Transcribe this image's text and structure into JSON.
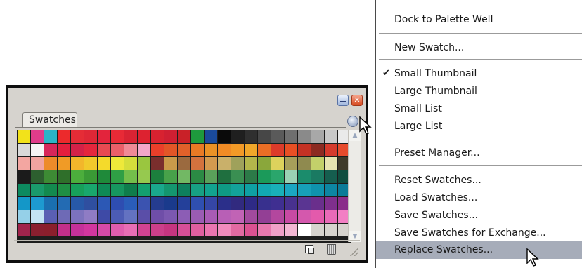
{
  "palette": {
    "tab_label": "Swatches",
    "close_glyph": "✕",
    "scroll_up": "▲",
    "scroll_down": "▼",
    "swatch_colors": [
      "#f2e21a",
      "#e03c8a",
      "#2bb4c7",
      "#ec2a2c",
      "#e52c36",
      "#df2736",
      "#e3243c",
      "#e82a36",
      "#d92333",
      "#dd2230",
      "#d82230",
      "#cf1f32",
      "#c92128",
      "#1e9a3d",
      "#1a4a9a",
      "#0a0a0a",
      "#1f1f1f",
      "#2f2f2f",
      "#474747",
      "#5a5a5a",
      "#6f6f6f",
      "#8a8a8a",
      "#a8a8a8",
      "#c9c9c9",
      "#eaeaea",
      "#d9d9d9",
      "#f5f5f5",
      "#d7265a",
      "#e41f3e",
      "#d42148",
      "#e4263d",
      "#e74a52",
      "#e95f69",
      "#ef8a96",
      "#f3a6c8",
      "#ea3f2a",
      "#e25627",
      "#e0612a",
      "#e97a25",
      "#ea9226",
      "#f08b25",
      "#f29a27",
      "#f0a72a",
      "#ea6e25",
      "#dd3b2a",
      "#e84f24",
      "#c43124",
      "#8c2a21",
      "#d53a2c",
      "#e74b2d",
      "#f3a6a1",
      "#f0a4a0",
      "#ed8b2a",
      "#f09b26",
      "#f2b62b",
      "#f1c92c",
      "#f4da2b",
      "#eee93a",
      "#d5de3b",
      "#9ac63f",
      "#7a2e2d",
      "#c99a4a",
      "#9b6a3f",
      "#d3723e",
      "#d39a4f",
      "#c9b06a",
      "#9fa15b",
      "#b3b64b",
      "#8aa73b",
      "#ddd25c",
      "#a69f5a",
      "#8f8a4f",
      "#c3d06a",
      "#e6e3b0",
      "#3f3a2a",
      "#1b1b1b",
      "#2d5f2f",
      "#3d8b34",
      "#2f6f2a",
      "#4cae3c",
      "#3a9a35",
      "#1f8a3a",
      "#2f9f45",
      "#74be4b",
      "#96c94f",
      "#1c7f3d",
      "#47a24a",
      "#72b864",
      "#2b8a44",
      "#5aa15a",
      "#1f6f3f",
      "#3a8f52",
      "#2c7a48",
      "#1b9a5a",
      "#2aa66c",
      "#9bd1b4",
      "#1b8c6c",
      "#1a7a62",
      "#155e4f",
      "#0f4d3f",
      "#0d8a5f",
      "#1a9a6b",
      "#138a4f",
      "#1f8f43",
      "#17a05a",
      "#19a76d",
      "#0f8a56",
      "#17965f",
      "#0f7d4c",
      "#14a06f",
      "#1aa88c",
      "#14966f",
      "#0e7f5e",
      "#17a083",
      "#12a38f",
      "#0f9a84",
      "#13a29a",
      "#0fa0a3",
      "#12a8b2",
      "#19b0b9",
      "#1ba6c2",
      "#17a0b8",
      "#0f93ad",
      "#0d86a3",
      "#0b7b98",
      "#1497c8",
      "#1d9ad0",
      "#1a6fb0",
      "#236bb3",
      "#2759a8",
      "#2f4fa0",
      "#2c58b5",
      "#2e4db1",
      "#2a5db9",
      "#3b53b0",
      "#253c8f",
      "#1a3a8c",
      "#24409a",
      "#2f4fb0",
      "#3546a6",
      "#2b2f8a",
      "#312a7f",
      "#2e2a86",
      "#38308e",
      "#3f2f91",
      "#48318f",
      "#5a3592",
      "#6a2f8c",
      "#7f2f8d",
      "#8a2d8a",
      "#95d0e8",
      "#c3e3f3",
      "#5a5fb3",
      "#6e6ab6",
      "#7c72bd",
      "#8f7cc4",
      "#3e4aa6",
      "#4c5cb5",
      "#6372c1",
      "#5a4ea8",
      "#6f4ea8",
      "#7b58b0",
      "#8c5db5",
      "#9a5cb3",
      "#a85bb4",
      "#b85fb6",
      "#c163b5",
      "#a24a9d",
      "#933f95",
      "#b3479e",
      "#c84aa3",
      "#d458ad",
      "#e35aac",
      "#e96ab8",
      "#f27fc4",
      "#a0244c",
      "#8a1f2f",
      "#8a1f2c",
      "#c22f8a",
      "#c5319a",
      "#d2369f",
      "#d64aa8",
      "#e05dae",
      "#e86eb5",
      "#d14392",
      "#cc3f8a",
      "#c63580",
      "#d74f98",
      "#e05fa0",
      "#ea75b0",
      "#f08bbd",
      "#e26aa2",
      "#db5191",
      "#e878ae",
      "#f0a0c8",
      "#f3b7d3",
      "#ffffff",
      "#d6d3ce",
      "#d6d3ce",
      "#d6d3ce"
    ]
  },
  "menu": {
    "items": [
      {
        "label": "Dock to Palette Well",
        "checked": false
      },
      {
        "label": "New Swatch...",
        "checked": false
      },
      {
        "label": "Small Thumbnail",
        "checked": true
      },
      {
        "label": "Large Thumbnail",
        "checked": false
      },
      {
        "label": "Small List",
        "checked": false
      },
      {
        "label": "Large List",
        "checked": false
      },
      {
        "label": "Preset Manager...",
        "checked": false
      },
      {
        "label": "Reset Swatches...",
        "checked": false
      },
      {
        "label": "Load Swatches...",
        "checked": false
      },
      {
        "label": "Save Swatches...",
        "checked": false
      },
      {
        "label": "Save Swatches for Exchange...",
        "checked": false
      },
      {
        "label": "Replace Swatches...",
        "checked": false,
        "highlighted": true
      }
    ],
    "check_glyph": "✔"
  }
}
